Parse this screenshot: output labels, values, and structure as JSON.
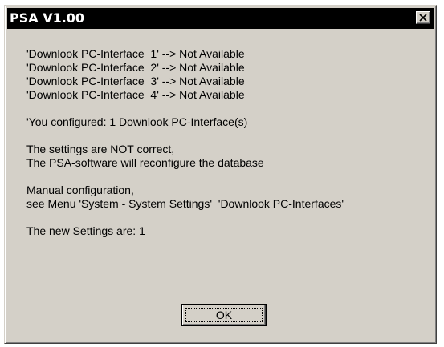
{
  "window": {
    "title": "PSA V1.00",
    "close_icon": "close-x-icon"
  },
  "message": {
    "interfaces": [
      "'Downlook PC-Interface  1' --> Not Available",
      "'Downlook PC-Interface  2' --> Not Available",
      "'Downlook PC-Interface  3' --> Not Available",
      "'Downlook PC-Interface  4' --> Not Available"
    ],
    "configured": "'You configured: 1 Downlook PC-Interface(s)",
    "settings_status": "The settings are NOT correct,",
    "reconfigure": "The PSA-software will reconfigure the database",
    "manual_config": "Manual configuration,",
    "menu_hint": "see Menu 'System - System Settings'  'Downlook PC-Interfaces'",
    "new_settings": "The new Settings are: 1"
  },
  "buttons": {
    "ok_label": "OK"
  }
}
